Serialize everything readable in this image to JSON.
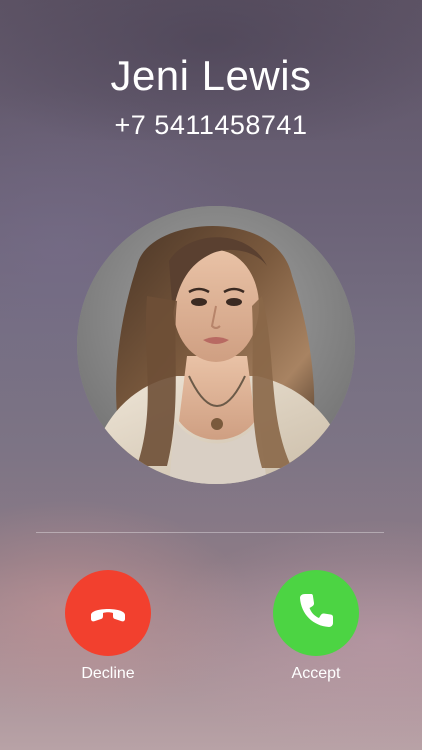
{
  "caller": {
    "name": "Jeni Lewis",
    "number": "+7 5411458741"
  },
  "actions": {
    "decline_label": "Decline",
    "accept_label": "Accept"
  },
  "icons": {
    "decline": "phone-hangup-icon",
    "accept": "phone-icon"
  },
  "colors": {
    "decline": "#f2402e",
    "accept": "#4cd443",
    "text": "#ffffff"
  }
}
